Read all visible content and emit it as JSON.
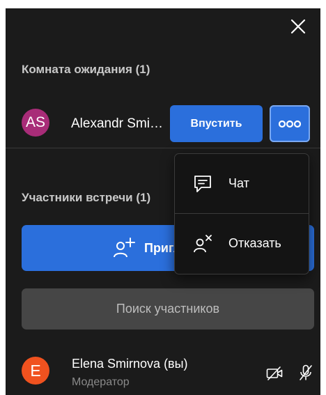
{
  "waiting_room": {
    "title": "Комната ожидания (1)",
    "guest": {
      "initials": "AS",
      "name": "Alexandr Smirnov",
      "avatar_color": "#a82c78"
    },
    "admit_label": "Впустить",
    "more_icon": "more-dots-icon"
  },
  "participants": {
    "title": "Участники встречи (1)",
    "invite_label": "Пригласить",
    "invite_icon": "add-person-icon",
    "search_placeholder": "Поиск участников",
    "self": {
      "initials": "E",
      "name": "Elena Smirnova (вы)",
      "role": "Модератор",
      "avatar_color": "#f0521f",
      "camera_icon": "camera-off-icon",
      "mic_icon": "mic-off-icon"
    }
  },
  "menu": {
    "chat_label": "Чат",
    "chat_icon": "chat-icon",
    "reject_label": "Отказать",
    "reject_icon": "remove-person-icon"
  },
  "colors": {
    "panel_bg": "#1b1b1b",
    "accent": "#2b6fdc",
    "search_bg": "#464646"
  }
}
